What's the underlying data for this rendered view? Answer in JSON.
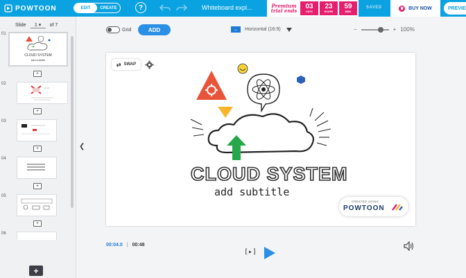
{
  "topbar": {
    "logo_text": "POWTOON",
    "mode_edit": "EDIT",
    "mode_create": "CREATE",
    "help": "?",
    "doc_title": "Whiteboard expl...",
    "trial_label": "Premium trial ends",
    "countdown": [
      {
        "value": "03",
        "unit": "DAYS"
      },
      {
        "value": "23",
        "unit": "HOURS"
      },
      {
        "value": "59",
        "unit": "MINS"
      }
    ],
    "saved": "SAVED",
    "buy_now": "BUY NOW",
    "preview": "PREVIE"
  },
  "slides_panel": {
    "label": "Slide",
    "current": "1",
    "total_text": "of 7",
    "thumbnail_numbers": [
      "01",
      "02",
      "03",
      "04",
      "05",
      "06"
    ],
    "thumb1_title": "CLOUD SYSTEM",
    "thumb1_subtitle": "add subtitle"
  },
  "toolbar": {
    "grid_label": "Grid",
    "add_label": "ADD",
    "aspect_label": "Horizontal (16:9)",
    "zoom_minus": "−",
    "zoom_plus": "+",
    "zoom_value": "100%"
  },
  "canvas": {
    "swap_label": "SWAP",
    "title": "CLOUD SYSTEM",
    "subtitle": "add subtitle",
    "created_using": "CREATED USING",
    "brand": "POWTOON"
  },
  "playback": {
    "current_time": "00:04.0",
    "total_time": "00:48",
    "frame_icon": "[▸]"
  },
  "colors": {
    "topbar": "#0aa2e0",
    "accent_blue": "#2b8fe6",
    "trial_pink": "#e61e6e",
    "triangle_red": "#e8543a",
    "triangle_yellow": "#f7b52c",
    "arrow_green": "#26a84a",
    "hexagon_blue": "#2b5fb8"
  }
}
